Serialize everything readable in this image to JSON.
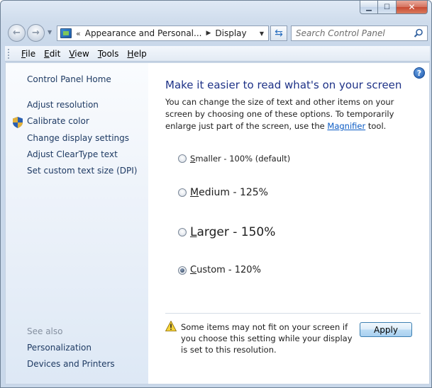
{
  "nav": {
    "address_chevron": "«",
    "breadcrumb": [
      "Appearance and Personal...",
      "Display"
    ],
    "breadcrumb_separator": "▶",
    "search_placeholder": "Search Control Panel"
  },
  "menu": {
    "items": [
      {
        "label": "File",
        "accel": "F",
        "rest": "ile"
      },
      {
        "label": "Edit",
        "accel": "E",
        "rest": "dit"
      },
      {
        "label": "View",
        "accel": "V",
        "rest": "iew"
      },
      {
        "label": "Tools",
        "accel": "T",
        "rest": "ools"
      },
      {
        "label": "Help",
        "accel": "H",
        "rest": "elp"
      }
    ]
  },
  "sidebar": {
    "home": "Control Panel Home",
    "links": [
      "Adjust resolution",
      "Calibrate color",
      "Change display settings",
      "Adjust ClearType text",
      "Set custom text size (DPI)"
    ],
    "see_also_label": "See also",
    "see_also": [
      "Personalization",
      "Devices and Printers"
    ]
  },
  "main": {
    "heading": "Make it easier to read what's on your screen",
    "description_before": "You can change the size of text and other items on your screen by choosing one of these options. To temporarily enlarge just part of the screen, use the ",
    "description_link": "Magnifier",
    "description_after": " tool.",
    "options": [
      {
        "accel": "S",
        "rest": "maller - 100% (default)",
        "checked": false
      },
      {
        "accel": "M",
        "rest": "edium - 125%",
        "checked": false
      },
      {
        "accel": "L",
        "rest": "arger - 150%",
        "checked": false
      },
      {
        "accel": "C",
        "rest": "ustom - 120%",
        "checked": true
      }
    ],
    "warning": "Some items may not fit on your screen if you choose this setting while your display is set to this resolution.",
    "apply_label": "Apply"
  },
  "help_glyph": "?"
}
